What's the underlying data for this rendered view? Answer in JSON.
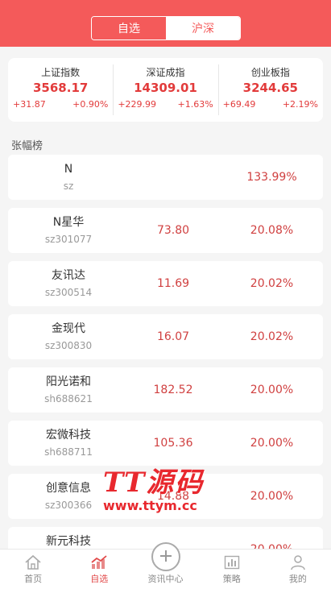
{
  "header": {
    "tabs": [
      {
        "label": "自选"
      },
      {
        "label": "沪深"
      }
    ]
  },
  "indices": [
    {
      "name": "上证指数",
      "value": "3568.17",
      "change": "+31.87",
      "percent": "+0.90%"
    },
    {
      "name": "深证成指",
      "value": "14309.01",
      "change": "+229.99",
      "percent": "+1.63%"
    },
    {
      "name": "创业板指",
      "value": "3244.65",
      "change": "+69.49",
      "percent": "+2.19%"
    }
  ],
  "section": {
    "title": "张幅榜"
  },
  "rows": [
    {
      "name": "N",
      "code": "sz",
      "price": "",
      "percent": "133.99%"
    },
    {
      "name": "N星华",
      "code": "sz301077",
      "price": "73.80",
      "percent": "20.08%"
    },
    {
      "name": "友讯达",
      "code": "sz300514",
      "price": "11.69",
      "percent": "20.02%"
    },
    {
      "name": "金现代",
      "code": "sz300830",
      "price": "16.07",
      "percent": "20.02%"
    },
    {
      "name": "阳光诺和",
      "code": "sh688621",
      "price": "182.52",
      "percent": "20.00%"
    },
    {
      "name": "宏微科技",
      "code": "sh688711",
      "price": "105.36",
      "percent": "20.00%"
    },
    {
      "name": "创意信息",
      "code": "sz300366",
      "price": "14.88",
      "percent": "20.00%"
    },
    {
      "name": "新元科技",
      "code": "",
      "price": "",
      "percent": "20.00%"
    }
  ],
  "watermark": {
    "title": "TT源码",
    "url": "www.ttym.cc"
  },
  "tabbar": {
    "items": [
      {
        "label": "首页",
        "icon": "home-icon"
      },
      {
        "label": "自选",
        "icon": "chart-icon"
      },
      {
        "label": "资讯中心",
        "icon": "plus-icon"
      },
      {
        "label": "策略",
        "icon": "bar-chart-icon"
      },
      {
        "label": "我的",
        "icon": "user-icon"
      }
    ]
  },
  "colors": {
    "accent": "#f45a5a",
    "up": "#e23b3b"
  }
}
